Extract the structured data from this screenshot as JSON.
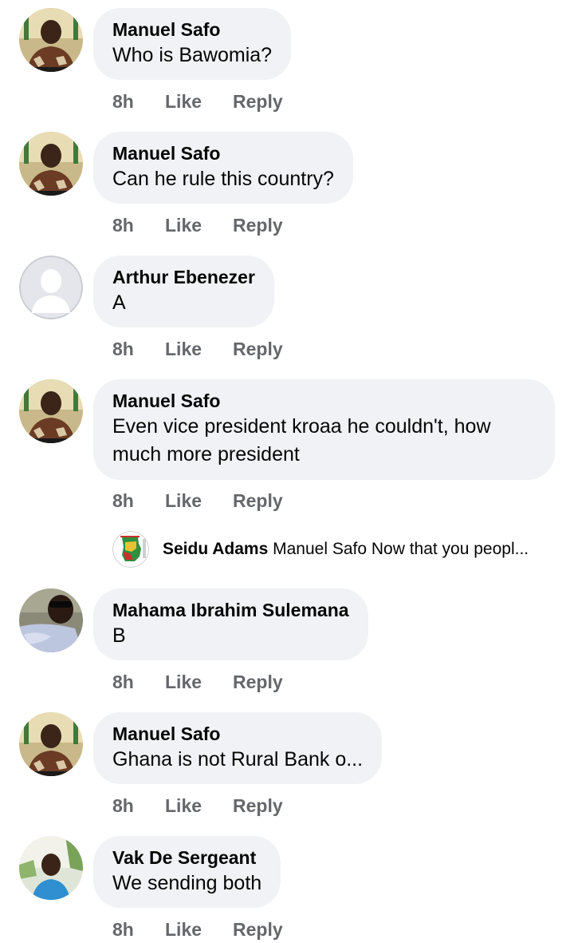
{
  "comments": [
    {
      "author": "Manuel Safo",
      "text": "Who is Bawomia?",
      "time": "8h",
      "like": "Like",
      "reply": "Reply",
      "avatar": "portrait-man-suit-icon"
    },
    {
      "author": "Manuel Safo",
      "text": "Can he rule this country?",
      "time": "8h",
      "like": "Like",
      "reply": "Reply",
      "avatar": "portrait-man-suit-icon"
    },
    {
      "author": "Arthur Ebenezer",
      "text": "A",
      "time": "8h",
      "like": "Like",
      "reply": "Reply",
      "avatar": "default-profile-icon"
    },
    {
      "author": "Manuel Safo",
      "text": "Even vice president kroaa he couldn't, how much more president",
      "time": "8h",
      "like": "Like",
      "reply": "Reply",
      "avatar": "portrait-man-suit-icon"
    },
    {
      "author": "Mahama Ibrahim Sulemana",
      "text": "B",
      "time": "8h",
      "like": "Like",
      "reply": "Reply",
      "avatar": "portrait-man-sunglasses-icon"
    },
    {
      "author": "Manuel Safo",
      "text": "Ghana is not Rural Bank o...",
      "time": "8h",
      "like": "Like",
      "reply": "Reply",
      "avatar": "portrait-man-suit-icon"
    },
    {
      "author": "Vak De Sergeant",
      "text": "We sending both",
      "time": "8h",
      "like": "Like",
      "reply": "Reply",
      "avatar": "portrait-young-man-icon"
    }
  ],
  "reply_preview": {
    "author": "Seidu Adams",
    "snippet": "Manuel Safo Now that you peopl...",
    "avatar": "ghana-map-icon"
  },
  "colors": {
    "bubble": "#f0f2f5",
    "meta_text": "#65676b",
    "text": "#050505"
  }
}
